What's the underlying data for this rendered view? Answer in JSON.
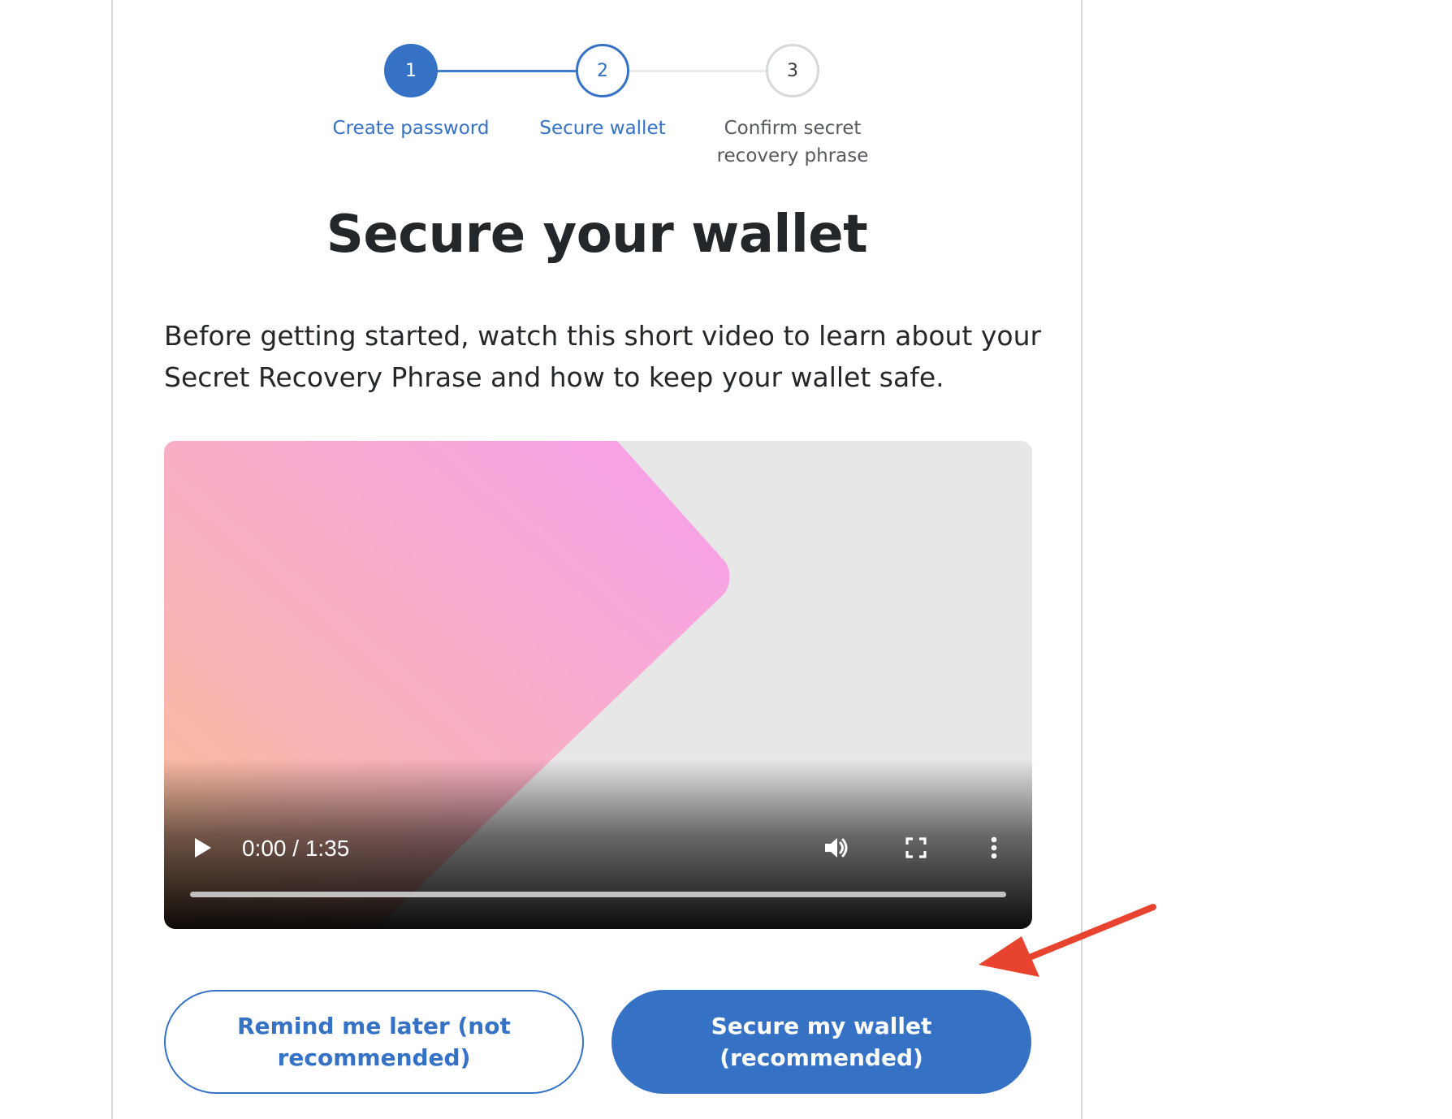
{
  "stepper": {
    "steps": [
      {
        "number": "1",
        "label": "Create password",
        "state": "done"
      },
      {
        "number": "2",
        "label": "Secure wallet",
        "state": "current"
      },
      {
        "number": "3",
        "label": "Confirm secret recovery phrase",
        "state": "todo"
      }
    ]
  },
  "main": {
    "title": "Secure your wallet",
    "description": "Before getting started, watch this short video to learn about your Secret Recovery Phrase and how to keep your wallet safe."
  },
  "video": {
    "time_display": "0:00 / 1:35",
    "progress_fraction": 0.0,
    "controls": [
      "play-icon",
      "volume-icon",
      "fullscreen-icon",
      "more-options-icon"
    ]
  },
  "actions": {
    "remind_later_label": "Remind me later (not recommended)",
    "secure_wallet_label": "Secure my wallet (recommended)"
  },
  "colors": {
    "primary": "#3572c6",
    "annotation_arrow": "#e8432f"
  }
}
